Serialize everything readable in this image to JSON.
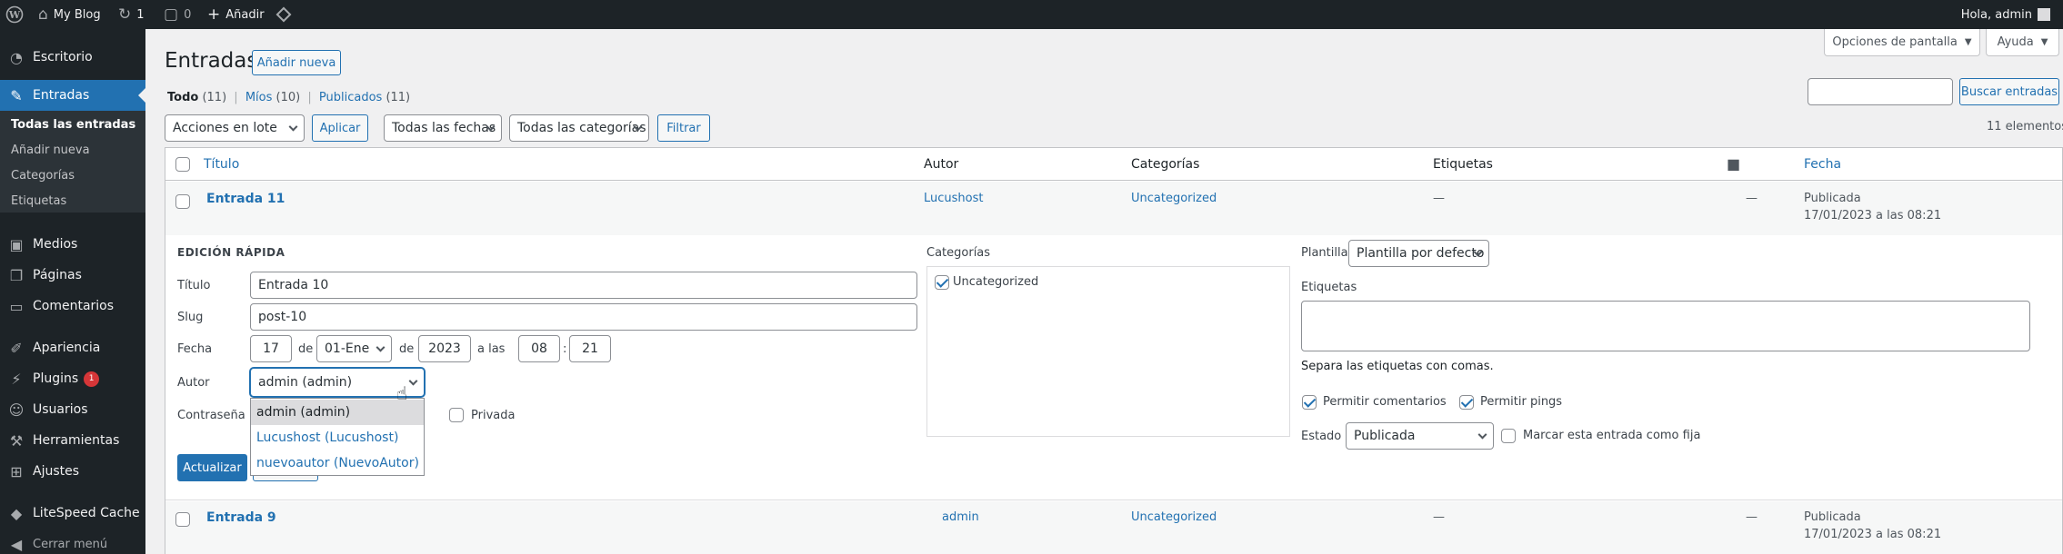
{
  "admin_bar": {
    "site_name": "My Blog",
    "updates_count": "1",
    "comments_count": "0",
    "add_new": "Añadir",
    "greeting": "Hola, admin"
  },
  "sidebar": {
    "dashboard": "Escritorio",
    "posts": "Entradas",
    "posts_sub": [
      "Todas las entradas",
      "Añadir nueva",
      "Categorías",
      "Etiquetas"
    ],
    "media": "Medios",
    "pages": "Páginas",
    "comments": "Comentarios",
    "appearance": "Apariencia",
    "plugins": "Plugins",
    "plugins_badge": "1",
    "users": "Usuarios",
    "tools": "Herramientas",
    "settings": "Ajustes",
    "litespeed": "LiteSpeed Cache",
    "collapse": "Cerrar menú"
  },
  "header": {
    "title": "Entradas",
    "add_new": "Añadir nueva",
    "screen_options": "Opciones de pantalla",
    "help": "Ayuda"
  },
  "filters": {
    "all_label": "Todo",
    "all_count": "(11)",
    "mine_label": "Míos",
    "mine_count": "(10)",
    "published_label": "Publicados",
    "published_count": "(11)",
    "sep": "|",
    "search_value": "",
    "search_button": "Buscar entradas",
    "bulk_actions": "Acciones en lote",
    "apply": "Aplicar",
    "all_dates": "Todas las fechas",
    "all_categories": "Todas las categorías",
    "filter": "Filtrar",
    "items_count": "11 elementos"
  },
  "table": {
    "columns": {
      "title": "Título",
      "author": "Autor",
      "categories": "Categorías",
      "tags": "Etiquetas",
      "date": "Fecha"
    },
    "rows": [
      {
        "title": "Entrada 11",
        "author": "Lucushost",
        "category": "Uncategorized",
        "tags": "—",
        "comments": "—",
        "status": "Publicada",
        "date": "17/01/2023 a las 08:21"
      },
      {
        "title": "Entrada 9",
        "author": "admin",
        "category": "Uncategorized",
        "tags": "—",
        "comments": "—",
        "status": "Publicada",
        "date": "17/01/2023 a las 08:21"
      }
    ]
  },
  "quick_edit": {
    "heading": "EDICIÓN RÁPIDA",
    "title_label": "Título",
    "title_value": "Entrada 10",
    "slug_label": "Slug",
    "slug_value": "post-10",
    "date_label": "Fecha",
    "day": "17",
    "de1": "de",
    "month": "01-Ene",
    "de2": "de",
    "year": "2023",
    "at": "a las",
    "hour": "08",
    "colon": ":",
    "minute": "21",
    "author_label": "Autor",
    "author_value": "admin (admin)",
    "author_options": [
      "admin (admin)",
      "Lucushost (Lucushost)",
      "nuevoautor (NuevoAutor)"
    ],
    "password_label": "Contraseña",
    "private_label": "Privada",
    "update_button": "Actualizar",
    "categories_label": "Categorías",
    "category_item": "Uncategorized",
    "template_label": "Plantilla",
    "template_value": "Plantilla por defecto",
    "tags_label": "Etiquetas",
    "tags_hint": "Separa las etiquetas con comas.",
    "allow_comments": "Permitir comentarios",
    "allow_pings": "Permitir pings",
    "status_label": "Estado",
    "status_value": "Publicada",
    "sticky_label": "Marcar esta entrada como fija"
  },
  "colors": {
    "accent": "#2271b1",
    "admin_bar": "#1d2327",
    "badge": "#d63638"
  }
}
